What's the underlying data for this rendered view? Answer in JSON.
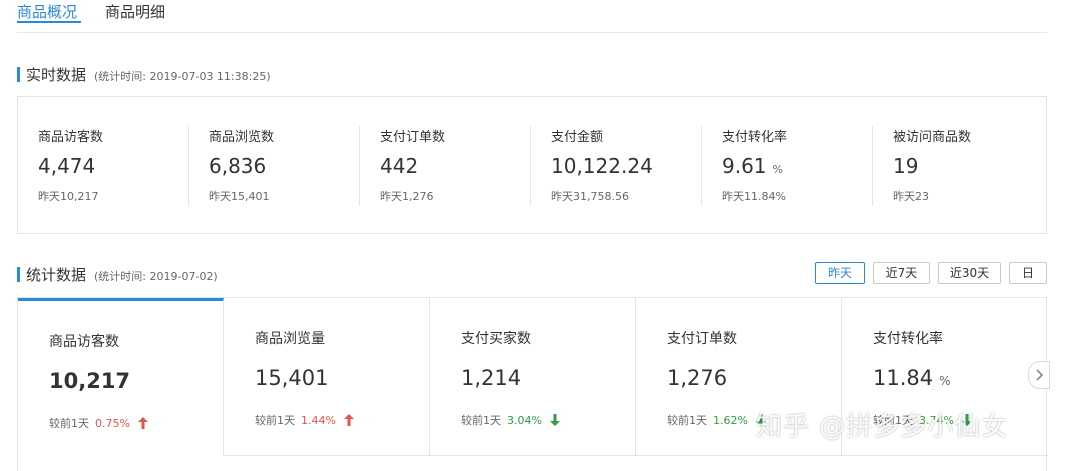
{
  "tabs": [
    {
      "label": "商品概况",
      "active": true
    },
    {
      "label": "商品明细",
      "active": false
    }
  ],
  "realtime": {
    "title": "实时数据",
    "subtitle": "(统计时间: 2019-07-03 11:38:25)",
    "items": [
      {
        "label": "商品访客数",
        "value": "4,474",
        "unit": "",
        "yesterday": "昨天10,217"
      },
      {
        "label": "商品浏览数",
        "value": "6,836",
        "unit": "",
        "yesterday": "昨天15,401"
      },
      {
        "label": "支付订单数",
        "value": "442",
        "unit": "",
        "yesterday": "昨天1,276"
      },
      {
        "label": "支付金额",
        "value": "10,122.24",
        "unit": "",
        "yesterday": "昨天31,758.56"
      },
      {
        "label": "支付转化率",
        "value": "9.61",
        "unit": "%",
        "yesterday": "昨天11.84%"
      },
      {
        "label": "被访问商品数",
        "value": "19",
        "unit": "",
        "yesterday": "昨天23"
      }
    ]
  },
  "stats": {
    "title": "统计数据",
    "subtitle": "(统计时间: 2019-07-02)",
    "ranges": [
      {
        "label": "昨天",
        "active": true
      },
      {
        "label": "近7天",
        "active": false
      },
      {
        "label": "近30天",
        "active": false
      },
      {
        "label": "日",
        "active": false
      }
    ],
    "cards": [
      {
        "label": "商品访客数",
        "value": "10,217",
        "unit": "",
        "compare_label": "较前1天",
        "compare_pct": "0.75%",
        "trend": "up"
      },
      {
        "label": "商品浏览量",
        "value": "15,401",
        "unit": "",
        "compare_label": "较前1天",
        "compare_pct": "1.44%",
        "trend": "up"
      },
      {
        "label": "支付买家数",
        "value": "1,214",
        "unit": "",
        "compare_label": "较前1天",
        "compare_pct": "3.04%",
        "trend": "down"
      },
      {
        "label": "支付订单数",
        "value": "1,276",
        "unit": "",
        "compare_label": "较前1天",
        "compare_pct": "1.62%",
        "trend": "down"
      },
      {
        "label": "支付转化率",
        "value": "11.84",
        "unit": "%",
        "compare_label": "较前1天",
        "compare_pct": "3.74%",
        "trend": "down"
      }
    ]
  },
  "watermark": "知乎 @拼多多小仙女",
  "colors": {
    "accent": "#2b8ad8",
    "up": "#e0564b",
    "down": "#2f9e44"
  },
  "icons": {
    "next": "chevron-right-icon",
    "up": "arrow-up-icon",
    "down": "arrow-down-icon"
  }
}
